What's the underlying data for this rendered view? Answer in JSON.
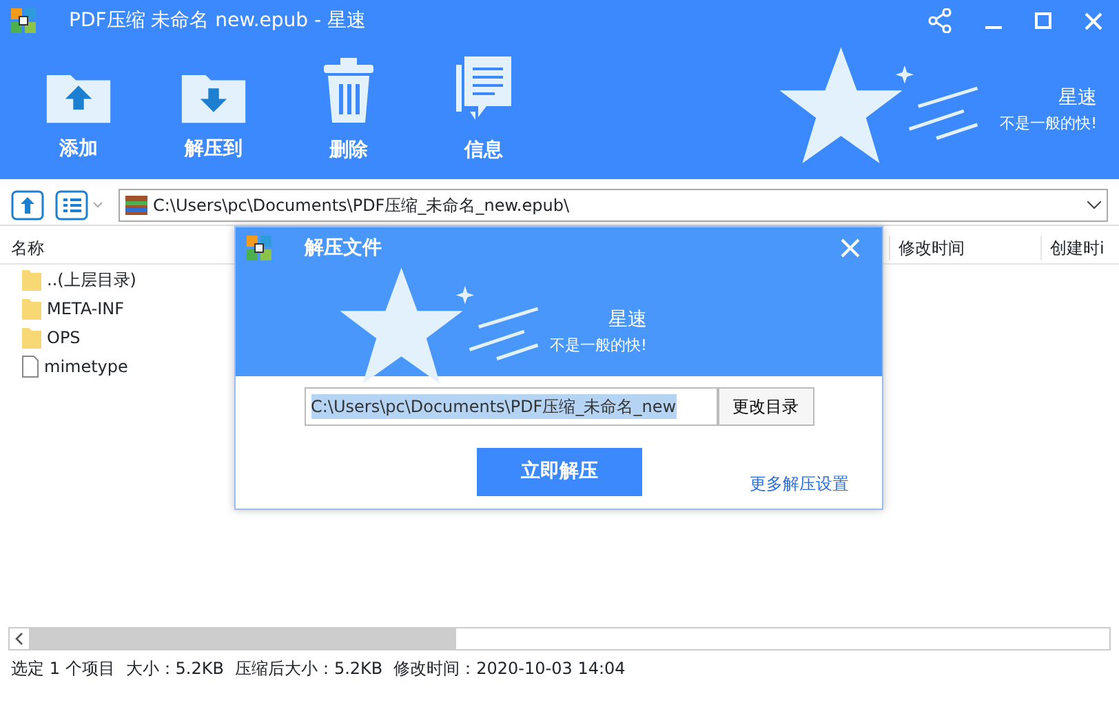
{
  "window": {
    "title": "PDF压缩 未命名 new.epub - 星速"
  },
  "toolbar": {
    "buttons": [
      {
        "label": "添加",
        "kind": "add"
      },
      {
        "label": "解压到",
        "kind": "extract"
      },
      {
        "label": "删除",
        "kind": "delete"
      },
      {
        "label": "信息",
        "kind": "info"
      }
    ]
  },
  "brand": {
    "name": "星速",
    "slogan": "不是一般的快!"
  },
  "address_bar": {
    "path": "C:\\Users\\pc\\Documents\\PDF压缩_未命名_new.epub\\"
  },
  "file_list": {
    "columns": [
      "名称",
      "修改时间",
      "创建时i"
    ],
    "rows": [
      {
        "name": "..(上层目录)",
        "kind": "folder"
      },
      {
        "name": "META-INF",
        "kind": "folder"
      },
      {
        "name": "OPS",
        "kind": "folder"
      },
      {
        "name": "mimetype",
        "kind": "file"
      }
    ]
  },
  "dialog": {
    "title": "解压文件",
    "brand_name": "星速",
    "slogan": "不是一般的快!",
    "path": "C:\\Users\\pc\\Documents\\PDF压缩_未命名_new",
    "change_button": "更改目录",
    "extract_button": "立即解压",
    "more_link": "更多解压设置"
  },
  "status_bar": [
    "选定 1 个项目",
    "大小：5.2KB",
    "压缩后大小：5.2KB",
    "修改时间：2020-10-03 14:04"
  ]
}
